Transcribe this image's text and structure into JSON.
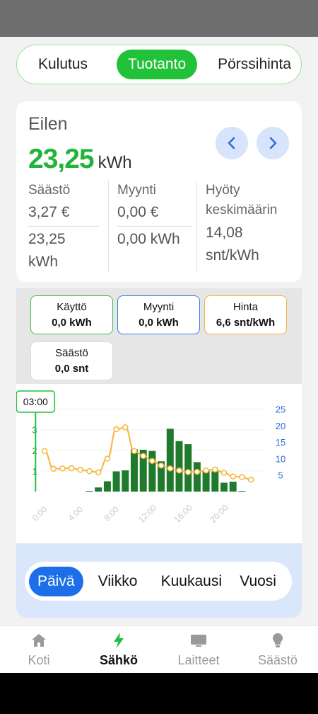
{
  "tabs": {
    "items": [
      "Kulutus",
      "Tuotanto",
      "Pörssihinta"
    ],
    "active": "Tuotanto"
  },
  "summary": {
    "period": "Eilen",
    "prev_icon": "chevron-left-icon",
    "next_icon": "chevron-right-icon",
    "total_value": "23,25",
    "total_unit": "kWh",
    "savings_label": "Säästö",
    "savings_money": "3,27 €",
    "savings_energy": "23,25 kWh",
    "sales_label": "Myynti",
    "sales_money": "0,00 €",
    "sales_energy": "0,00 kWh",
    "benefit_label": "Hyöty keskimäärin",
    "benefit_value": "14,08 snt/kWh"
  },
  "chips": [
    {
      "name": "Käyttö",
      "value": "0,0 kWh",
      "border": "#3cbf4f"
    },
    {
      "name": "Myynti",
      "value": "0,0 kWh",
      "border": "#3d7ee6"
    },
    {
      "name": "Hinta",
      "value": "6,6 snt/kWh",
      "border": "#f2b33d"
    },
    {
      "name": "Säästö",
      "value": "0,0 snt",
      "border": "#dddddd"
    }
  ],
  "colors": {
    "production": "#1f7a2c",
    "price": "#f6b53b",
    "accent": "#22c13a",
    "blue": "#1c6fe8"
  },
  "chart_data": {
    "type": "bar",
    "marker_label": "03:00",
    "categories": [
      "0:00",
      "1:00",
      "2:00",
      "3:00",
      "4:00",
      "5:00",
      "6:00",
      "7:00",
      "8:00",
      "9:00",
      "10:00",
      "11:00",
      "12:00",
      "13:00",
      "14:00",
      "15:00",
      "16:00",
      "17:00",
      "18:00",
      "19:00",
      "20:00",
      "21:00",
      "22:00",
      "23:00"
    ],
    "x_ticks": [
      "0:00",
      "4:00",
      "8:00",
      "12:00",
      "16:00",
      "20:00"
    ],
    "series": [
      {
        "axis": "left",
        "type": "bar",
        "values": [
          0,
          0,
          0,
          0,
          0,
          0.03,
          0.2,
          0.5,
          0.98,
          1.03,
          2.05,
          2.03,
          1.97,
          1.47,
          3.05,
          2.45,
          2.3,
          1.43,
          1.03,
          0.98,
          0.43,
          0.48,
          0.03,
          0
        ]
      },
      {
        "axis": "right",
        "type": "line",
        "values": [
          12.3,
          6.9,
          7.0,
          7.1,
          6.6,
          6.2,
          5.8,
          10.0,
          18.9,
          19.5,
          12.3,
          10.8,
          9.3,
          7.9,
          7.0,
          6.4,
          5.9,
          6.0,
          6.4,
          6.7,
          5.7,
          4.6,
          4.4,
          3.6
        ]
      }
    ],
    "yleft_ticks": [
      1,
      2,
      3,
      4
    ],
    "yleft_lim": [
      0,
      4.4
    ],
    "yright_ticks": [
      5,
      10,
      15,
      20,
      25
    ],
    "yright_lim": [
      0,
      27.5
    ]
  },
  "period_tabs": {
    "items": [
      "Päivä",
      "Viikko",
      "Kuukausi",
      "Vuosi"
    ],
    "active": "Päivä"
  },
  "bottom_nav": [
    {
      "label": "Koti",
      "icon": "home-icon"
    },
    {
      "label": "Sähkö",
      "icon": "lightning-icon"
    },
    {
      "label": "Laitteet",
      "icon": "device-icon"
    },
    {
      "label": "Säästö",
      "icon": "lightbulb-icon"
    }
  ]
}
